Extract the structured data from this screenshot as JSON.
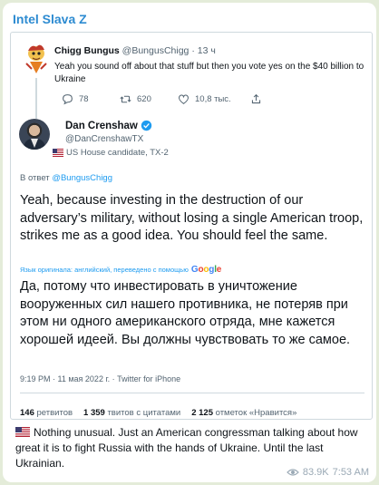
{
  "channel": {
    "name": "Intel Slava Z"
  },
  "reply_tweet": {
    "author_name": "Chigg Bungus",
    "author_handle": "@BungusChigg",
    "time": "· 13 ч",
    "text": "Yeah you sound off about that stuff but then you vote yes on the $40 billion to Ukraine",
    "replies": "78",
    "retweets": "620",
    "likes": "10,8 тыс."
  },
  "main_tweet": {
    "author_name": "Dan Crenshaw",
    "author_handle": "@DanCrenshawTX",
    "label": "US House candidate, TX-2",
    "reply_prefix": "В ответ",
    "reply_to": "@BungusChigg",
    "text_en": "Yeah, because investing in the destruction of our adversary’s military, without losing a single American troop, strikes me as a good idea. You should feel the same.",
    "translate_note": "Язык оригинала: английский, переведено с помощью",
    "translate_brand": "Google",
    "text_ru": "Да, потому что инвестировать в уничтожение вооруженных сил нашего противника, не потеряв при этом ни одного американского отряда, мне кажется хорошей идеей. Вы должны чувствовать то же самое.",
    "meta": "9:19 PM · 11 мая 2022 г. · Twitter for iPhone",
    "stats": {
      "retweets_count": "146",
      "retweets_label": "ретвитов",
      "quotes_count": "1 359",
      "quotes_label": "твитов с цитатами",
      "likes_count": "2 125",
      "likes_label": "отметок «Нравится»"
    }
  },
  "caption": "Nothing unusual. Just an American congressman talking about how great it is to fight Russia with the hands of Ukraine. Until the last Ukrainian.",
  "footer": {
    "views": "83.9K",
    "time": "7:53 AM"
  },
  "colors": {
    "channel_name": "#2d8bd1",
    "link": "#1d9bf0",
    "background": "#e4ecd9",
    "verified": "#1d9bf0"
  }
}
